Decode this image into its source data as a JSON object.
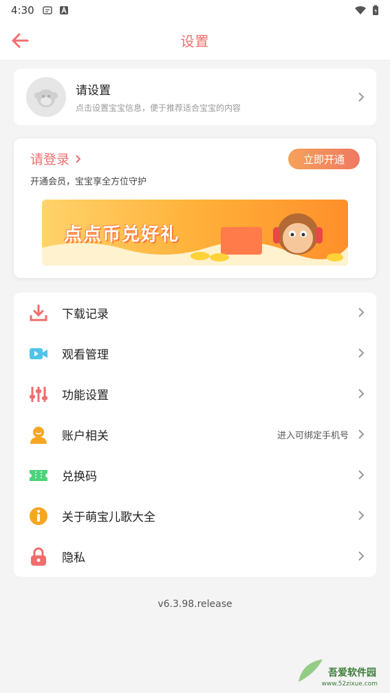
{
  "status_bar": {
    "time": "4:30"
  },
  "header": {
    "title": "设置"
  },
  "profile": {
    "title": "请设置",
    "subtitle": "点击设置宝宝信息，便于推荐适合宝宝的内容"
  },
  "membership": {
    "login_label": "请登录",
    "subtitle": "开通会员，宝宝享全方位守护",
    "open_button": "立即开通",
    "banner_text": "点点币兑好礼"
  },
  "menu": {
    "items": [
      {
        "label": "下载记录",
        "icon": "download-icon",
        "color": "#ef6d6d"
      },
      {
        "label": "观看管理",
        "icon": "video-icon",
        "color": "#4fc3e8"
      },
      {
        "label": "功能设置",
        "icon": "sliders-icon",
        "color": "#ef6d6d"
      },
      {
        "label": "账户相关",
        "icon": "user-icon",
        "color": "#f5a623",
        "hint": "进入可绑定手机号"
      },
      {
        "label": "兑换码",
        "icon": "ticket-icon",
        "color": "#4cd37b"
      },
      {
        "label": "关于萌宝儿歌大全",
        "icon": "info-icon",
        "color": "#f5a623"
      },
      {
        "label": "隐私",
        "icon": "lock-icon",
        "color": "#ef6d6d"
      }
    ]
  },
  "version": "v6.3.98.release",
  "watermark": {
    "text": "吾爱软件园",
    "url": "www.52zixue.com"
  },
  "colors": {
    "accent": "#f36d6d",
    "background": "#f4f4f4"
  }
}
